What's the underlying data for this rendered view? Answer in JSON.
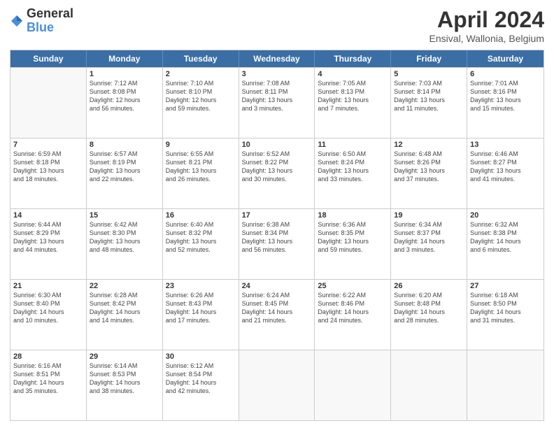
{
  "logo": {
    "general": "General",
    "blue": "Blue"
  },
  "title": "April 2024",
  "subtitle": "Ensival, Wallonia, Belgium",
  "header_days": [
    "Sunday",
    "Monday",
    "Tuesday",
    "Wednesday",
    "Thursday",
    "Friday",
    "Saturday"
  ],
  "weeks": [
    [
      {
        "day": "",
        "info": ""
      },
      {
        "day": "1",
        "info": "Sunrise: 7:12 AM\nSunset: 8:08 PM\nDaylight: 12 hours\nand 56 minutes."
      },
      {
        "day": "2",
        "info": "Sunrise: 7:10 AM\nSunset: 8:10 PM\nDaylight: 12 hours\nand 59 minutes."
      },
      {
        "day": "3",
        "info": "Sunrise: 7:08 AM\nSunset: 8:11 PM\nDaylight: 13 hours\nand 3 minutes."
      },
      {
        "day": "4",
        "info": "Sunrise: 7:05 AM\nSunset: 8:13 PM\nDaylight: 13 hours\nand 7 minutes."
      },
      {
        "day": "5",
        "info": "Sunrise: 7:03 AM\nSunset: 8:14 PM\nDaylight: 13 hours\nand 11 minutes."
      },
      {
        "day": "6",
        "info": "Sunrise: 7:01 AM\nSunset: 8:16 PM\nDaylight: 13 hours\nand 15 minutes."
      }
    ],
    [
      {
        "day": "7",
        "info": "Sunrise: 6:59 AM\nSunset: 8:18 PM\nDaylight: 13 hours\nand 18 minutes."
      },
      {
        "day": "8",
        "info": "Sunrise: 6:57 AM\nSunset: 8:19 PM\nDaylight: 13 hours\nand 22 minutes."
      },
      {
        "day": "9",
        "info": "Sunrise: 6:55 AM\nSunset: 8:21 PM\nDaylight: 13 hours\nand 26 minutes."
      },
      {
        "day": "10",
        "info": "Sunrise: 6:52 AM\nSunset: 8:22 PM\nDaylight: 13 hours\nand 30 minutes."
      },
      {
        "day": "11",
        "info": "Sunrise: 6:50 AM\nSunset: 8:24 PM\nDaylight: 13 hours\nand 33 minutes."
      },
      {
        "day": "12",
        "info": "Sunrise: 6:48 AM\nSunset: 8:26 PM\nDaylight: 13 hours\nand 37 minutes."
      },
      {
        "day": "13",
        "info": "Sunrise: 6:46 AM\nSunset: 8:27 PM\nDaylight: 13 hours\nand 41 minutes."
      }
    ],
    [
      {
        "day": "14",
        "info": "Sunrise: 6:44 AM\nSunset: 8:29 PM\nDaylight: 13 hours\nand 44 minutes."
      },
      {
        "day": "15",
        "info": "Sunrise: 6:42 AM\nSunset: 8:30 PM\nDaylight: 13 hours\nand 48 minutes."
      },
      {
        "day": "16",
        "info": "Sunrise: 6:40 AM\nSunset: 8:32 PM\nDaylight: 13 hours\nand 52 minutes."
      },
      {
        "day": "17",
        "info": "Sunrise: 6:38 AM\nSunset: 8:34 PM\nDaylight: 13 hours\nand 56 minutes."
      },
      {
        "day": "18",
        "info": "Sunrise: 6:36 AM\nSunset: 8:35 PM\nDaylight: 13 hours\nand 59 minutes."
      },
      {
        "day": "19",
        "info": "Sunrise: 6:34 AM\nSunset: 8:37 PM\nDaylight: 14 hours\nand 3 minutes."
      },
      {
        "day": "20",
        "info": "Sunrise: 6:32 AM\nSunset: 8:38 PM\nDaylight: 14 hours\nand 6 minutes."
      }
    ],
    [
      {
        "day": "21",
        "info": "Sunrise: 6:30 AM\nSunset: 8:40 PM\nDaylight: 14 hours\nand 10 minutes."
      },
      {
        "day": "22",
        "info": "Sunrise: 6:28 AM\nSunset: 8:42 PM\nDaylight: 14 hours\nand 14 minutes."
      },
      {
        "day": "23",
        "info": "Sunrise: 6:26 AM\nSunset: 8:43 PM\nDaylight: 14 hours\nand 17 minutes."
      },
      {
        "day": "24",
        "info": "Sunrise: 6:24 AM\nSunset: 8:45 PM\nDaylight: 14 hours\nand 21 minutes."
      },
      {
        "day": "25",
        "info": "Sunrise: 6:22 AM\nSunset: 8:46 PM\nDaylight: 14 hours\nand 24 minutes."
      },
      {
        "day": "26",
        "info": "Sunrise: 6:20 AM\nSunset: 8:48 PM\nDaylight: 14 hours\nand 28 minutes."
      },
      {
        "day": "27",
        "info": "Sunrise: 6:18 AM\nSunset: 8:50 PM\nDaylight: 14 hours\nand 31 minutes."
      }
    ],
    [
      {
        "day": "28",
        "info": "Sunrise: 6:16 AM\nSunset: 8:51 PM\nDaylight: 14 hours\nand 35 minutes."
      },
      {
        "day": "29",
        "info": "Sunrise: 6:14 AM\nSunset: 8:53 PM\nDaylight: 14 hours\nand 38 minutes."
      },
      {
        "day": "30",
        "info": "Sunrise: 6:12 AM\nSunset: 8:54 PM\nDaylight: 14 hours\nand 42 minutes."
      },
      {
        "day": "",
        "info": ""
      },
      {
        "day": "",
        "info": ""
      },
      {
        "day": "",
        "info": ""
      },
      {
        "day": "",
        "info": ""
      }
    ]
  ]
}
